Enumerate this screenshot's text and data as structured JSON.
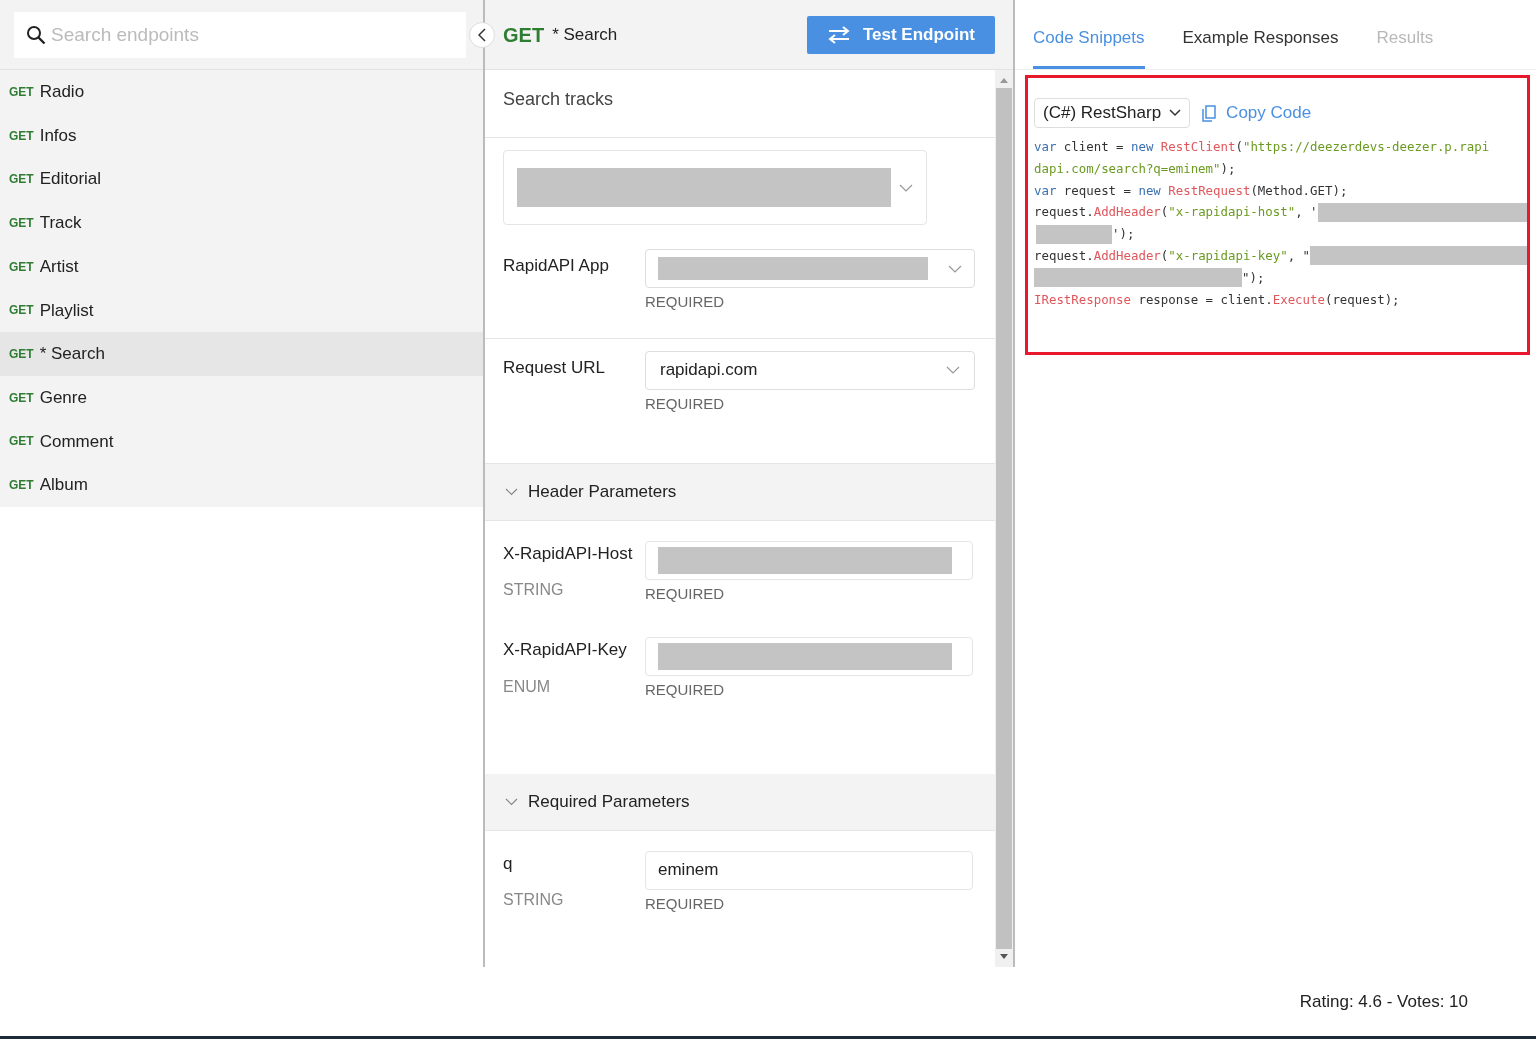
{
  "sidebar": {
    "search": {
      "placeholder": "Search endpoints"
    },
    "items": [
      {
        "method": "GET",
        "label": "Radio",
        "selected": false
      },
      {
        "method": "GET",
        "label": "Infos",
        "selected": false
      },
      {
        "method": "GET",
        "label": "Editorial",
        "selected": false
      },
      {
        "method": "GET",
        "label": "Track",
        "selected": false
      },
      {
        "method": "GET",
        "label": "Artist",
        "selected": false
      },
      {
        "method": "GET",
        "label": "Playlist",
        "selected": false
      },
      {
        "method": "GET",
        "label": "* Search",
        "selected": true
      },
      {
        "method": "GET",
        "label": "Genre",
        "selected": false
      },
      {
        "method": "GET",
        "label": "Comment",
        "selected": false
      },
      {
        "method": "GET",
        "label": "Album",
        "selected": false
      }
    ]
  },
  "endpoint": {
    "method": "GET",
    "name": "* Search",
    "test_button": "Test Endpoint",
    "description": "Search tracks",
    "app": {
      "label": "RapidAPI App",
      "required": "REQUIRED"
    },
    "url": {
      "label": "Request URL",
      "value": "rapidapi.com",
      "required": "REQUIRED"
    },
    "sections": [
      {
        "title": "Header Parameters",
        "expanded": true,
        "params": [
          {
            "name": "X-RapidAPI-Host",
            "type": "STRING",
            "value_redacted": true,
            "required": "REQUIRED"
          },
          {
            "name": "X-RapidAPI-Key",
            "type": "ENUM",
            "value_redacted": true,
            "required": "REQUIRED"
          }
        ]
      },
      {
        "title": "Required Parameters",
        "expanded": true,
        "params": [
          {
            "name": "q",
            "type": "STRING",
            "value": "eminem",
            "value_redacted": false,
            "required": "REQUIRED"
          }
        ]
      }
    ]
  },
  "right": {
    "tabs": [
      {
        "label": "Code Snippets",
        "selected": true,
        "disabled": false
      },
      {
        "label": "Example Responses",
        "selected": false,
        "disabled": false
      },
      {
        "label": "Results",
        "selected": false,
        "disabled": true
      }
    ],
    "language": "(C#) RestSharp",
    "copy": "Copy Code",
    "code_lines": [
      [
        {
          "kind": "keyword",
          "text": "var"
        },
        {
          "kind": "plain",
          "text": " client = "
        },
        {
          "kind": "keyword",
          "text": "new"
        },
        {
          "kind": "type",
          "text": " RestClient"
        },
        {
          "kind": "plain",
          "text": "("
        },
        {
          "kind": "string",
          "text": "\"https://deezerdevs-deezer.p.rapi"
        }
      ],
      [
        {
          "kind": "string",
          "text": "dapi.com/search?q=eminem\""
        },
        {
          "kind": "plain",
          "text": ");"
        }
      ],
      [
        {
          "kind": "keyword",
          "text": "var"
        },
        {
          "kind": "plain",
          "text": " request = "
        },
        {
          "kind": "keyword",
          "text": "new"
        },
        {
          "kind": "type",
          "text": " RestRequest"
        },
        {
          "kind": "plain",
          "text": "(Method.GET);"
        }
      ],
      [
        {
          "kind": "plain",
          "text": "request."
        },
        {
          "kind": "type",
          "text": "AddHeader"
        },
        {
          "kind": "plain",
          "text": "("
        },
        {
          "kind": "string",
          "text": "\"x-rapidapi-host\""
        },
        {
          "kind": "plain",
          "text": ", '"
        },
        {
          "kind": "redacted"
        }
      ],
      [
        {
          "kind": "redacted"
        },
        {
          "kind": "plain",
          "text": "');"
        }
      ],
      [
        {
          "kind": "plain",
          "text": "request."
        },
        {
          "kind": "type",
          "text": "AddHeader"
        },
        {
          "kind": "plain",
          "text": "("
        },
        {
          "kind": "string",
          "text": "\"x-rapidapi-key\""
        },
        {
          "kind": "plain",
          "text": ", \""
        },
        {
          "kind": "redacted"
        }
      ],
      [
        {
          "kind": "redacted"
        },
        {
          "kind": "plain",
          "text": "\");"
        }
      ],
      [
        {
          "kind": "type",
          "text": "IRestResponse"
        },
        {
          "kind": "plain",
          "text": " response = client."
        },
        {
          "kind": "type",
          "text": "Execute"
        },
        {
          "kind": "plain",
          "text": "(request);"
        }
      ]
    ]
  },
  "footer": {
    "rating": "Rating: 4.6 - Votes: 10"
  }
}
